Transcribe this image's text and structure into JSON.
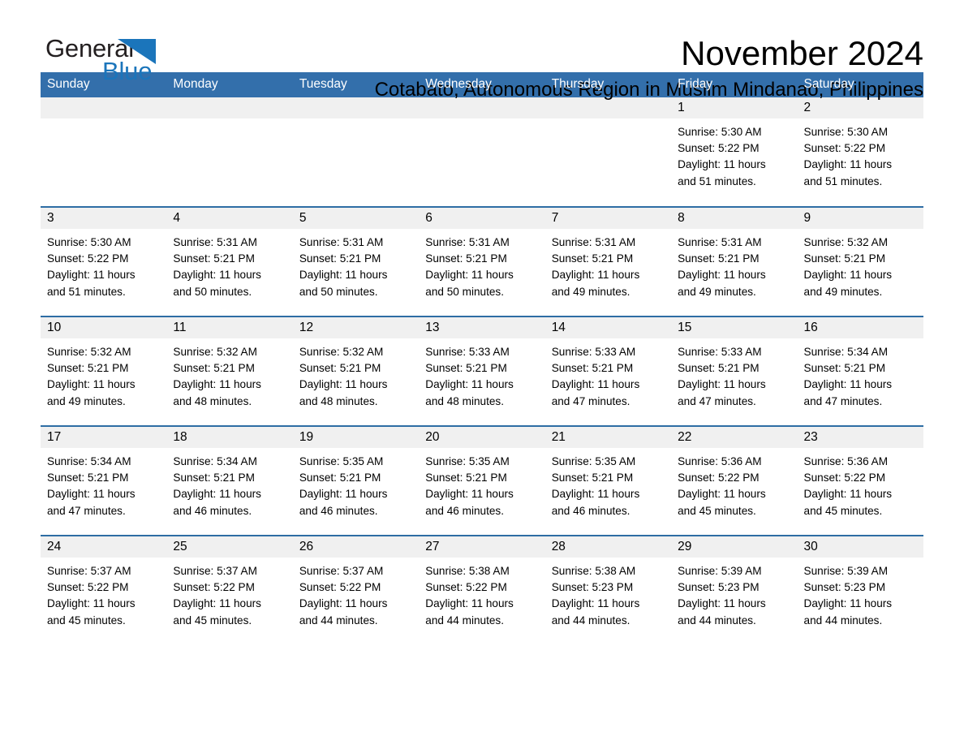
{
  "brand": {
    "name_part1": "General",
    "name_part2": "Blue",
    "triangle_color": "#1b75bb",
    "text_color": "#231f20"
  },
  "header": {
    "title": "November 2024",
    "subtitle": "Cotabato, Autonomous Region in Muslim Mindanao, Philippines"
  },
  "colors": {
    "header_blue": "#336fab",
    "row_divider_blue": "#2e6da4",
    "daynum_band": "#f0f0f0",
    "page_background": "#ffffff"
  },
  "calendar": {
    "weekday_headers": [
      "Sunday",
      "Monday",
      "Tuesday",
      "Wednesday",
      "Thursday",
      "Friday",
      "Saturday"
    ],
    "weeks": [
      [
        {
          "day": "",
          "sunrise": "",
          "sunset": "",
          "daylight_line1": "",
          "daylight_line2": ""
        },
        {
          "day": "",
          "sunrise": "",
          "sunset": "",
          "daylight_line1": "",
          "daylight_line2": ""
        },
        {
          "day": "",
          "sunrise": "",
          "sunset": "",
          "daylight_line1": "",
          "daylight_line2": ""
        },
        {
          "day": "",
          "sunrise": "",
          "sunset": "",
          "daylight_line1": "",
          "daylight_line2": ""
        },
        {
          "day": "",
          "sunrise": "",
          "sunset": "",
          "daylight_line1": "",
          "daylight_line2": ""
        },
        {
          "day": "1",
          "sunrise": "Sunrise: 5:30 AM",
          "sunset": "Sunset: 5:22 PM",
          "daylight_line1": "Daylight: 11 hours",
          "daylight_line2": "and 51 minutes."
        },
        {
          "day": "2",
          "sunrise": "Sunrise: 5:30 AM",
          "sunset": "Sunset: 5:22 PM",
          "daylight_line1": "Daylight: 11 hours",
          "daylight_line2": "and 51 minutes."
        }
      ],
      [
        {
          "day": "3",
          "sunrise": "Sunrise: 5:30 AM",
          "sunset": "Sunset: 5:22 PM",
          "daylight_line1": "Daylight: 11 hours",
          "daylight_line2": "and 51 minutes."
        },
        {
          "day": "4",
          "sunrise": "Sunrise: 5:31 AM",
          "sunset": "Sunset: 5:21 PM",
          "daylight_line1": "Daylight: 11 hours",
          "daylight_line2": "and 50 minutes."
        },
        {
          "day": "5",
          "sunrise": "Sunrise: 5:31 AM",
          "sunset": "Sunset: 5:21 PM",
          "daylight_line1": "Daylight: 11 hours",
          "daylight_line2": "and 50 minutes."
        },
        {
          "day": "6",
          "sunrise": "Sunrise: 5:31 AM",
          "sunset": "Sunset: 5:21 PM",
          "daylight_line1": "Daylight: 11 hours",
          "daylight_line2": "and 50 minutes."
        },
        {
          "day": "7",
          "sunrise": "Sunrise: 5:31 AM",
          "sunset": "Sunset: 5:21 PM",
          "daylight_line1": "Daylight: 11 hours",
          "daylight_line2": "and 49 minutes."
        },
        {
          "day": "8",
          "sunrise": "Sunrise: 5:31 AM",
          "sunset": "Sunset: 5:21 PM",
          "daylight_line1": "Daylight: 11 hours",
          "daylight_line2": "and 49 minutes."
        },
        {
          "day": "9",
          "sunrise": "Sunrise: 5:32 AM",
          "sunset": "Sunset: 5:21 PM",
          "daylight_line1": "Daylight: 11 hours",
          "daylight_line2": "and 49 minutes."
        }
      ],
      [
        {
          "day": "10",
          "sunrise": "Sunrise: 5:32 AM",
          "sunset": "Sunset: 5:21 PM",
          "daylight_line1": "Daylight: 11 hours",
          "daylight_line2": "and 49 minutes."
        },
        {
          "day": "11",
          "sunrise": "Sunrise: 5:32 AM",
          "sunset": "Sunset: 5:21 PM",
          "daylight_line1": "Daylight: 11 hours",
          "daylight_line2": "and 48 minutes."
        },
        {
          "day": "12",
          "sunrise": "Sunrise: 5:32 AM",
          "sunset": "Sunset: 5:21 PM",
          "daylight_line1": "Daylight: 11 hours",
          "daylight_line2": "and 48 minutes."
        },
        {
          "day": "13",
          "sunrise": "Sunrise: 5:33 AM",
          "sunset": "Sunset: 5:21 PM",
          "daylight_line1": "Daylight: 11 hours",
          "daylight_line2": "and 48 minutes."
        },
        {
          "day": "14",
          "sunrise": "Sunrise: 5:33 AM",
          "sunset": "Sunset: 5:21 PM",
          "daylight_line1": "Daylight: 11 hours",
          "daylight_line2": "and 47 minutes."
        },
        {
          "day": "15",
          "sunrise": "Sunrise: 5:33 AM",
          "sunset": "Sunset: 5:21 PM",
          "daylight_line1": "Daylight: 11 hours",
          "daylight_line2": "and 47 minutes."
        },
        {
          "day": "16",
          "sunrise": "Sunrise: 5:34 AM",
          "sunset": "Sunset: 5:21 PM",
          "daylight_line1": "Daylight: 11 hours",
          "daylight_line2": "and 47 minutes."
        }
      ],
      [
        {
          "day": "17",
          "sunrise": "Sunrise: 5:34 AM",
          "sunset": "Sunset: 5:21 PM",
          "daylight_line1": "Daylight: 11 hours",
          "daylight_line2": "and 47 minutes."
        },
        {
          "day": "18",
          "sunrise": "Sunrise: 5:34 AM",
          "sunset": "Sunset: 5:21 PM",
          "daylight_line1": "Daylight: 11 hours",
          "daylight_line2": "and 46 minutes."
        },
        {
          "day": "19",
          "sunrise": "Sunrise: 5:35 AM",
          "sunset": "Sunset: 5:21 PM",
          "daylight_line1": "Daylight: 11 hours",
          "daylight_line2": "and 46 minutes."
        },
        {
          "day": "20",
          "sunrise": "Sunrise: 5:35 AM",
          "sunset": "Sunset: 5:21 PM",
          "daylight_line1": "Daylight: 11 hours",
          "daylight_line2": "and 46 minutes."
        },
        {
          "day": "21",
          "sunrise": "Sunrise: 5:35 AM",
          "sunset": "Sunset: 5:21 PM",
          "daylight_line1": "Daylight: 11 hours",
          "daylight_line2": "and 46 minutes."
        },
        {
          "day": "22",
          "sunrise": "Sunrise: 5:36 AM",
          "sunset": "Sunset: 5:22 PM",
          "daylight_line1": "Daylight: 11 hours",
          "daylight_line2": "and 45 minutes."
        },
        {
          "day": "23",
          "sunrise": "Sunrise: 5:36 AM",
          "sunset": "Sunset: 5:22 PM",
          "daylight_line1": "Daylight: 11 hours",
          "daylight_line2": "and 45 minutes."
        }
      ],
      [
        {
          "day": "24",
          "sunrise": "Sunrise: 5:37 AM",
          "sunset": "Sunset: 5:22 PM",
          "daylight_line1": "Daylight: 11 hours",
          "daylight_line2": "and 45 minutes."
        },
        {
          "day": "25",
          "sunrise": "Sunrise: 5:37 AM",
          "sunset": "Sunset: 5:22 PM",
          "daylight_line1": "Daylight: 11 hours",
          "daylight_line2": "and 45 minutes."
        },
        {
          "day": "26",
          "sunrise": "Sunrise: 5:37 AM",
          "sunset": "Sunset: 5:22 PM",
          "daylight_line1": "Daylight: 11 hours",
          "daylight_line2": "and 44 minutes."
        },
        {
          "day": "27",
          "sunrise": "Sunrise: 5:38 AM",
          "sunset": "Sunset: 5:22 PM",
          "daylight_line1": "Daylight: 11 hours",
          "daylight_line2": "and 44 minutes."
        },
        {
          "day": "28",
          "sunrise": "Sunrise: 5:38 AM",
          "sunset": "Sunset: 5:23 PM",
          "daylight_line1": "Daylight: 11 hours",
          "daylight_line2": "and 44 minutes."
        },
        {
          "day": "29",
          "sunrise": "Sunrise: 5:39 AM",
          "sunset": "Sunset: 5:23 PM",
          "daylight_line1": "Daylight: 11 hours",
          "daylight_line2": "and 44 minutes."
        },
        {
          "day": "30",
          "sunrise": "Sunrise: 5:39 AM",
          "sunset": "Sunset: 5:23 PM",
          "daylight_line1": "Daylight: 11 hours",
          "daylight_line2": "and 44 minutes."
        }
      ]
    ]
  }
}
